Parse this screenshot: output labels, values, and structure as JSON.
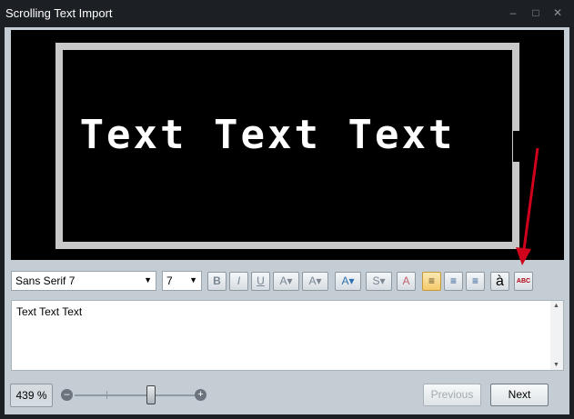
{
  "window": {
    "title": "Scrolling Text Import",
    "minimize_glyph": "–",
    "maximize_glyph": "□",
    "close_glyph": "✕"
  },
  "preview": {
    "text": "Text Text Text"
  },
  "toolbar": {
    "font_family": "Sans Serif 7",
    "font_size": "7",
    "bold_label": "B",
    "italic_label": "I",
    "underline_label": "U",
    "text_color_label": "A",
    "highlight_label": "A",
    "font_color_label": "A",
    "effects_label": "S",
    "outline_label": "A",
    "special_char_label": "à",
    "spellcheck_label": "ABC",
    "icons": [
      "bold-icon",
      "italic-icon",
      "underline-icon",
      "text-color-icon",
      "highlight-icon",
      "font-color-icon",
      "effects-icon",
      "outline-icon",
      "align-left-icon",
      "align-center-icon",
      "align-right-icon",
      "special-character-icon",
      "spellcheck-icon"
    ]
  },
  "editor": {
    "content": "Text Text Text"
  },
  "footer": {
    "zoom": "439 %",
    "zoom_minus": "–",
    "zoom_plus": "+",
    "previous_label": "Previous",
    "next_label": "Next"
  },
  "annotation": {
    "arrow_color": "#d0021b"
  }
}
